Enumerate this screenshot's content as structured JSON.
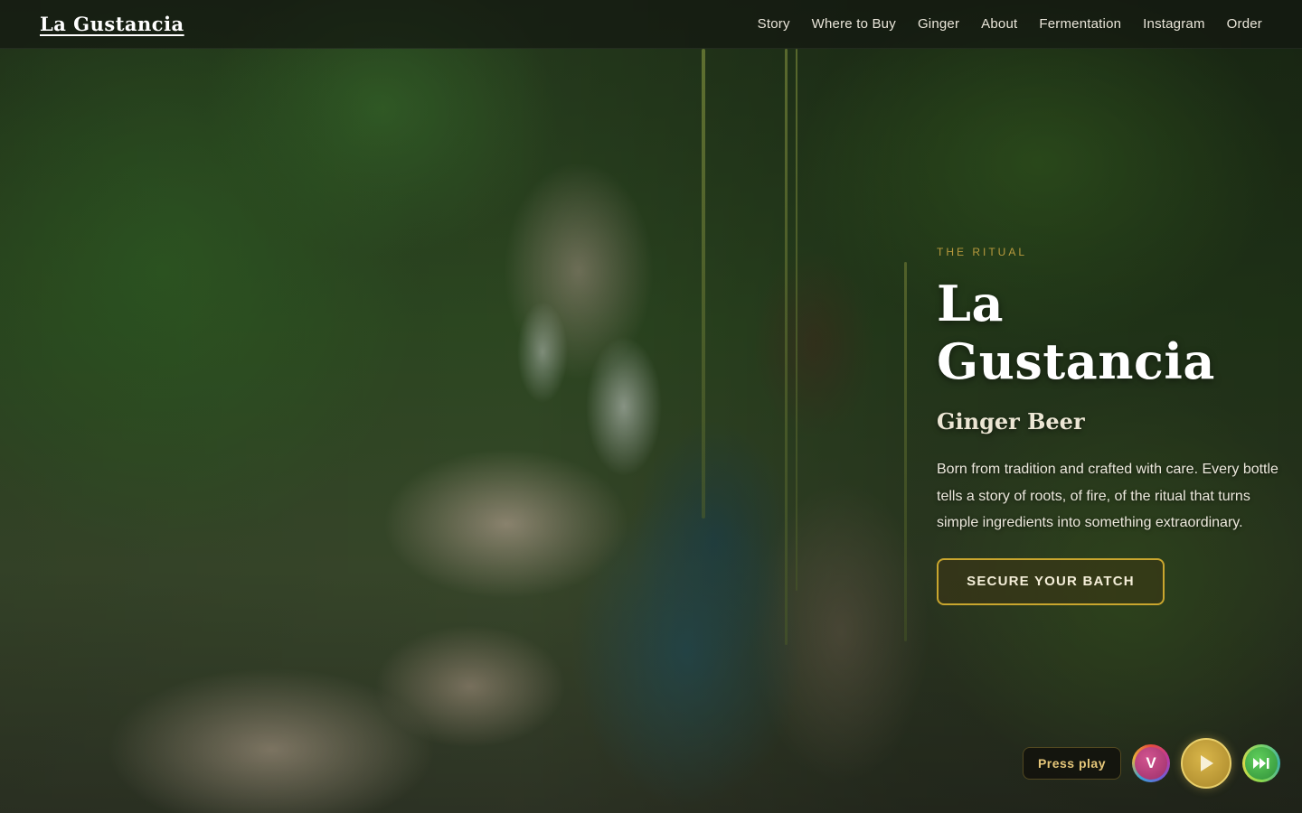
{
  "nav": {
    "brand": "La Gustancia",
    "links": [
      "Story",
      "Where to Buy",
      "Ginger",
      "About",
      "Fermentation",
      "Instagram",
      "Order"
    ]
  },
  "hero": {
    "eyebrow": "THE RITUAL",
    "title": "La Gustancia",
    "subtitle": "Ginger Beer",
    "body": "Born from tradition and crafted with care. Every bottle tells a story of roots, of fire, of the ritual that turns simple ingredients into something extraordinary.",
    "cta": "SECURE YOUR BATCH"
  },
  "media": {
    "label": "Press play",
    "v_badge": "V",
    "icons": [
      "v-badge-icon",
      "play-icon",
      "skip-forward-icon"
    ]
  },
  "colors": {
    "accent_gold": "#c9a62e",
    "eyebrow_gold": "#b89a3e",
    "nav_bg": "#14180f"
  }
}
